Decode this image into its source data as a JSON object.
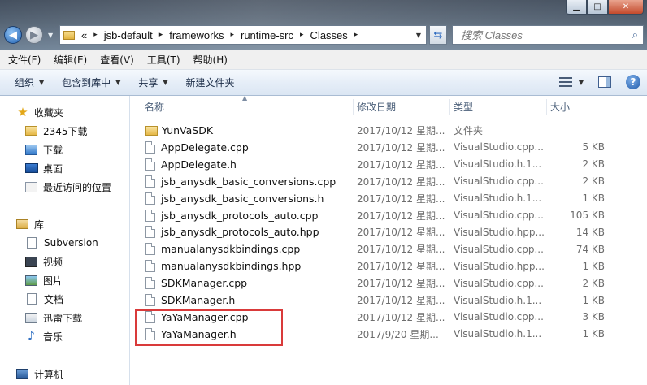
{
  "window": {
    "minimize_icon": "minimize-icon",
    "maximize_icon": "maximize-icon",
    "close_icon": "close-icon"
  },
  "address": {
    "prefix": "«",
    "crumbs": [
      "jsb-default",
      "frameworks",
      "runtime-src",
      "Classes"
    ],
    "separator": "▸"
  },
  "search": {
    "placeholder": "搜索 Classes"
  },
  "menu": [
    "文件(F)",
    "编辑(E)",
    "查看(V)",
    "工具(T)",
    "帮助(H)"
  ],
  "toolbar": {
    "organize": "组织",
    "include_in_library": "包含到库中",
    "share": "共享",
    "new_folder": "新建文件夹"
  },
  "nav": {
    "favorites": "收藏夹",
    "fav_items": [
      "2345下载",
      "下载",
      "桌面",
      "最近访问的位置"
    ],
    "library": "库",
    "lib_items": [
      "Subversion",
      "视频",
      "图片",
      "文档",
      "迅雷下载",
      "音乐"
    ],
    "computer": "计算机"
  },
  "columns": {
    "name": "名称",
    "date": "修改日期",
    "type": "类型",
    "size": "大小"
  },
  "files": [
    {
      "name": "YunVaSDK",
      "date": "2017/10/12 星期...",
      "type": "文件夹",
      "size": "",
      "kind": "folder"
    },
    {
      "name": "AppDelegate.cpp",
      "date": "2017/10/12 星期...",
      "type": "VisualStudio.cpp...",
      "size": "5 KB",
      "kind": "file"
    },
    {
      "name": "AppDelegate.h",
      "date": "2017/10/12 星期...",
      "type": "VisualStudio.h.1...",
      "size": "2 KB",
      "kind": "file"
    },
    {
      "name": "jsb_anysdk_basic_conversions.cpp",
      "date": "2017/10/12 星期...",
      "type": "VisualStudio.cpp...",
      "size": "2 KB",
      "kind": "file"
    },
    {
      "name": "jsb_anysdk_basic_conversions.h",
      "date": "2017/10/12 星期...",
      "type": "VisualStudio.h.1...",
      "size": "1 KB",
      "kind": "file"
    },
    {
      "name": "jsb_anysdk_protocols_auto.cpp",
      "date": "2017/10/12 星期...",
      "type": "VisualStudio.cpp...",
      "size": "105 KB",
      "kind": "file"
    },
    {
      "name": "jsb_anysdk_protocols_auto.hpp",
      "date": "2017/10/12 星期...",
      "type": "VisualStudio.hpp...",
      "size": "14 KB",
      "kind": "file"
    },
    {
      "name": "manualanysdkbindings.cpp",
      "date": "2017/10/12 星期...",
      "type": "VisualStudio.cpp...",
      "size": "74 KB",
      "kind": "file"
    },
    {
      "name": "manualanysdkbindings.hpp",
      "date": "2017/10/12 星期...",
      "type": "VisualStudio.hpp...",
      "size": "1 KB",
      "kind": "file"
    },
    {
      "name": "SDKManager.cpp",
      "date": "2017/10/12 星期...",
      "type": "VisualStudio.cpp...",
      "size": "2 KB",
      "kind": "file"
    },
    {
      "name": "SDKManager.h",
      "date": "2017/10/12 星期...",
      "type": "VisualStudio.h.1...",
      "size": "1 KB",
      "kind": "file"
    },
    {
      "name": "YaYaManager.cpp",
      "date": "2017/10/12 星期...",
      "type": "VisualStudio.cpp...",
      "size": "3 KB",
      "kind": "file"
    },
    {
      "name": "YaYaManager.h",
      "date": "2017/9/20 星期...",
      "type": "VisualStudio.h.1...",
      "size": "1 KB",
      "kind": "file"
    }
  ],
  "colors": {
    "highlight_border": "#d93a3a",
    "toolbar_text": "#1a2b46"
  }
}
